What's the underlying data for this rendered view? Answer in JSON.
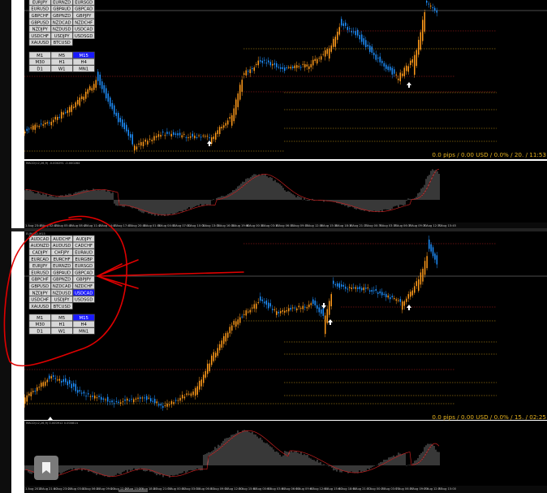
{
  "panels": [
    {
      "id": "top",
      "pairs_partial": [
        "EURJPY",
        "EURNZD",
        "EURSGD",
        "EURUSD",
        "GBPAUD",
        "GBPCAD",
        "GBPCHF",
        "GBPNZD",
        "GBPJPY",
        "GBPUSD",
        "NZDCAD",
        "NZDCHF",
        "NZDJPY",
        "NZDUSD",
        "USDCAD",
        "USDCHF",
        "USDJPY",
        "USDSGD",
        "XAUUSD",
        "BTCUSD"
      ],
      "timeframes": [
        "M1",
        "M5",
        "M15",
        "M30",
        "H1",
        "H4",
        "D1",
        "W1",
        "MN1"
      ],
      "active_timeframe": "M15",
      "info_text": "0.0 pips / 0.00 USD / 0.0% / 20. / 11:53",
      "indicator_label": "MACD(12,26,9) -0.000291 -0.000284",
      "date_ticks": [
        "1 Aug 23:45",
        "2 Aug 02:45",
        "2 Aug 05:45",
        "2 Aug 08:45",
        "2 Aug 11:45",
        "2 Aug 14:45",
        "2 Aug 17:45",
        "2 Aug 20:45",
        "3 Aug 01:00",
        "3 Aug 04:00",
        "3 Aug 07:00",
        "3 Aug 10:00",
        "3 Aug 13:00",
        "3 Aug 16:00",
        "3 Aug 19:00",
        "6 Aug 00:15",
        "6 Aug 03:15",
        "6 Aug 06:15",
        "6 Aug 09:15",
        "6 Aug 12:15",
        "6 Aug 15:15",
        "6 Aug 18:15",
        "6 Aug 21:15",
        "7 Aug 00:30",
        "7 Aug 03:30",
        "7 Aug 06:30",
        "7 Aug 09:30",
        "7 Aug 12:30",
        "7 Aug 15:45"
      ]
    },
    {
      "id": "bottom",
      "chart_title": "EURCAD,M15",
      "pairs": [
        "AUDCAD",
        "AUDCHF",
        "AUDJPY",
        "AUDNZD",
        "AUDUSD",
        "CADCHF",
        "CADJPY",
        "CHFJPY",
        "EURAUD",
        "EURCAD",
        "EURCHF",
        "EURGBP",
        "EURJPY",
        "EURNZD",
        "EURSGD",
        "EURUSD",
        "GBPAUD",
        "GBPCAD",
        "GBPCHF",
        "GBPNZD",
        "GBPJPY",
        "GBPUSD",
        "NZDCAD",
        "NZDCHF",
        "NZDJPY",
        "NZDUSD",
        "USDCAD",
        "USDCHF",
        "USDJPY",
        "USDSGD",
        "XAUUSD",
        "BTCUSD"
      ],
      "highlighted_pair": "USDCAD",
      "timeframes": [
        "M1",
        "M5",
        "M15",
        "M30",
        "H1",
        "H4",
        "D1",
        "W1",
        "MN1"
      ],
      "active_timeframe": "M15",
      "info_text": "0.0 pips / 0.00 USD / 0.0% / 15. / 02:25",
      "indicator_label": "MACD(12,26,9) 0.000912 0.000814",
      "date_ticks": [
        "1 Aug 2018",
        "1 Aug 21:00",
        "1 Aug 23:00",
        "2 Aug 03:00",
        "2 Aug 06:00",
        "2 Aug 09:00",
        "2 Aug 12:00",
        "2 Aug 15:00",
        "2 Aug 18:00",
        "2 Aug 21:00",
        "3 Aug 00:00",
        "3 Aug 03:00",
        "3 Aug 06:00",
        "3 Aug 09:00",
        "3 Aug 12:00",
        "3 Aug 15:00",
        "6 Aug 00:00",
        "6 Aug 03:00",
        "6 Aug 06:00",
        "6 Aug 09:00",
        "6 Aug 12:00",
        "6 Aug 15:00",
        "6 Aug 18:00",
        "6 Aug 21:00",
        "7 Aug 00:00",
        "7 Aug 03:00",
        "7 Aug 06:00",
        "7 Aug 09:00",
        "7 Aug 12:00",
        "7 Aug 15:00"
      ]
    }
  ],
  "annotation": {
    "color": "#e00000"
  },
  "colors": {
    "bull": "#1e90ff",
    "bear": "#ff9a1a",
    "background": "#000000",
    "level_dotted": "#d4a017",
    "level_red": "#c02020",
    "info": "#e8b420"
  },
  "bookmark": {
    "icon": "bookmark-icon"
  }
}
